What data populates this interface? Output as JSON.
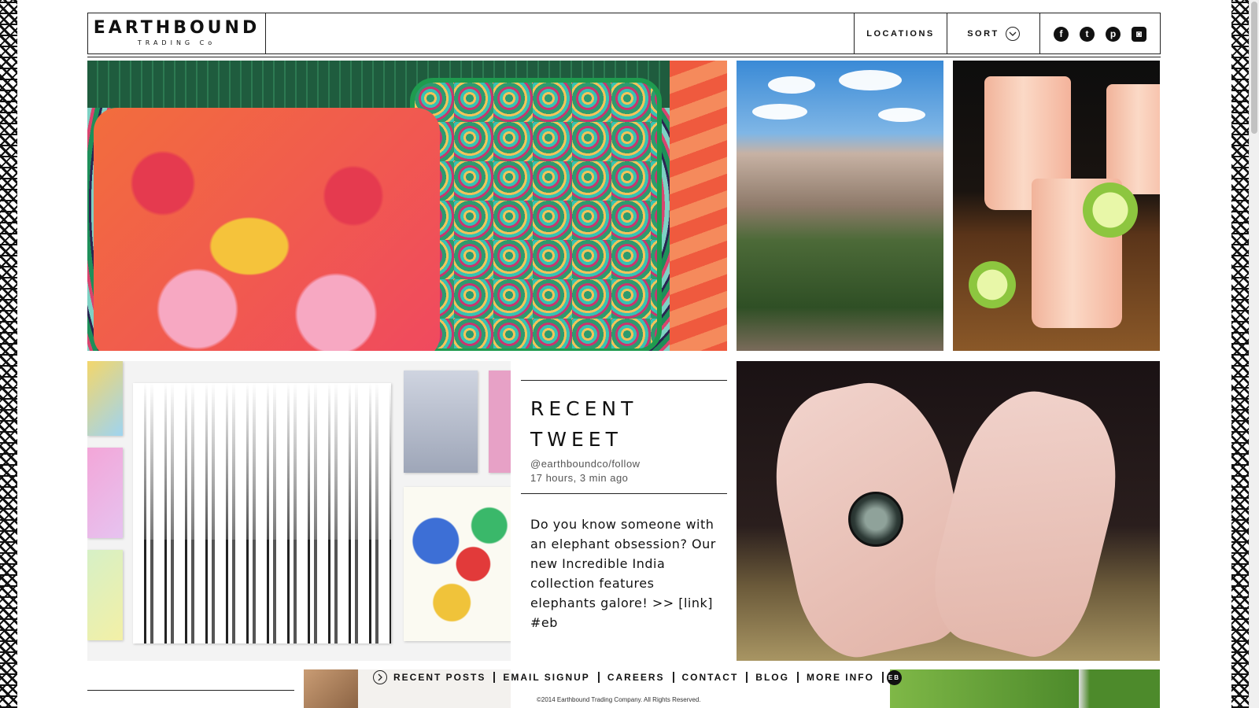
{
  "brand": {
    "name": "EARTHBOUND",
    "tagline": "TRADING Co"
  },
  "nav": {
    "locations": "LOCATIONS",
    "sort": "SORT"
  },
  "social": {
    "facebook": "f",
    "twitter": "t",
    "pinterest": "p",
    "instagram": "◙"
  },
  "icons": {
    "sort": "chevron-down-circle-icon",
    "facebook": "facebook-icon",
    "twitter": "twitter-icon",
    "pinterest": "pinterest-icon",
    "instagram": "instagram-icon",
    "recent_posts": "chevron-right-circle-icon",
    "more_info": "eb-badge-icon"
  },
  "tweet": {
    "title_line1": "RECENT",
    "title_line2": "TWEET",
    "handle": "@earthboundco/follow",
    "time": "17 hours, 3 min ago",
    "body": "Do you know someone with an elephant obsession? Our new Incredible India collection features elephants galore! >> [link] #eb"
  },
  "footer": {
    "recent_posts": "RECENT POSTS",
    "email_signup": "EMAIL SIGNUP",
    "careers": "CAREERS",
    "contact": "CONTACT",
    "blog": "BLOG",
    "more_info": "MORE INFO",
    "eb_badge": "EB",
    "copyright": "©2014 Earthbound Trading Company. All Rights Reserved."
  },
  "colors": {
    "text": "#111111",
    "rule": "#222222",
    "background": "#ffffff"
  }
}
